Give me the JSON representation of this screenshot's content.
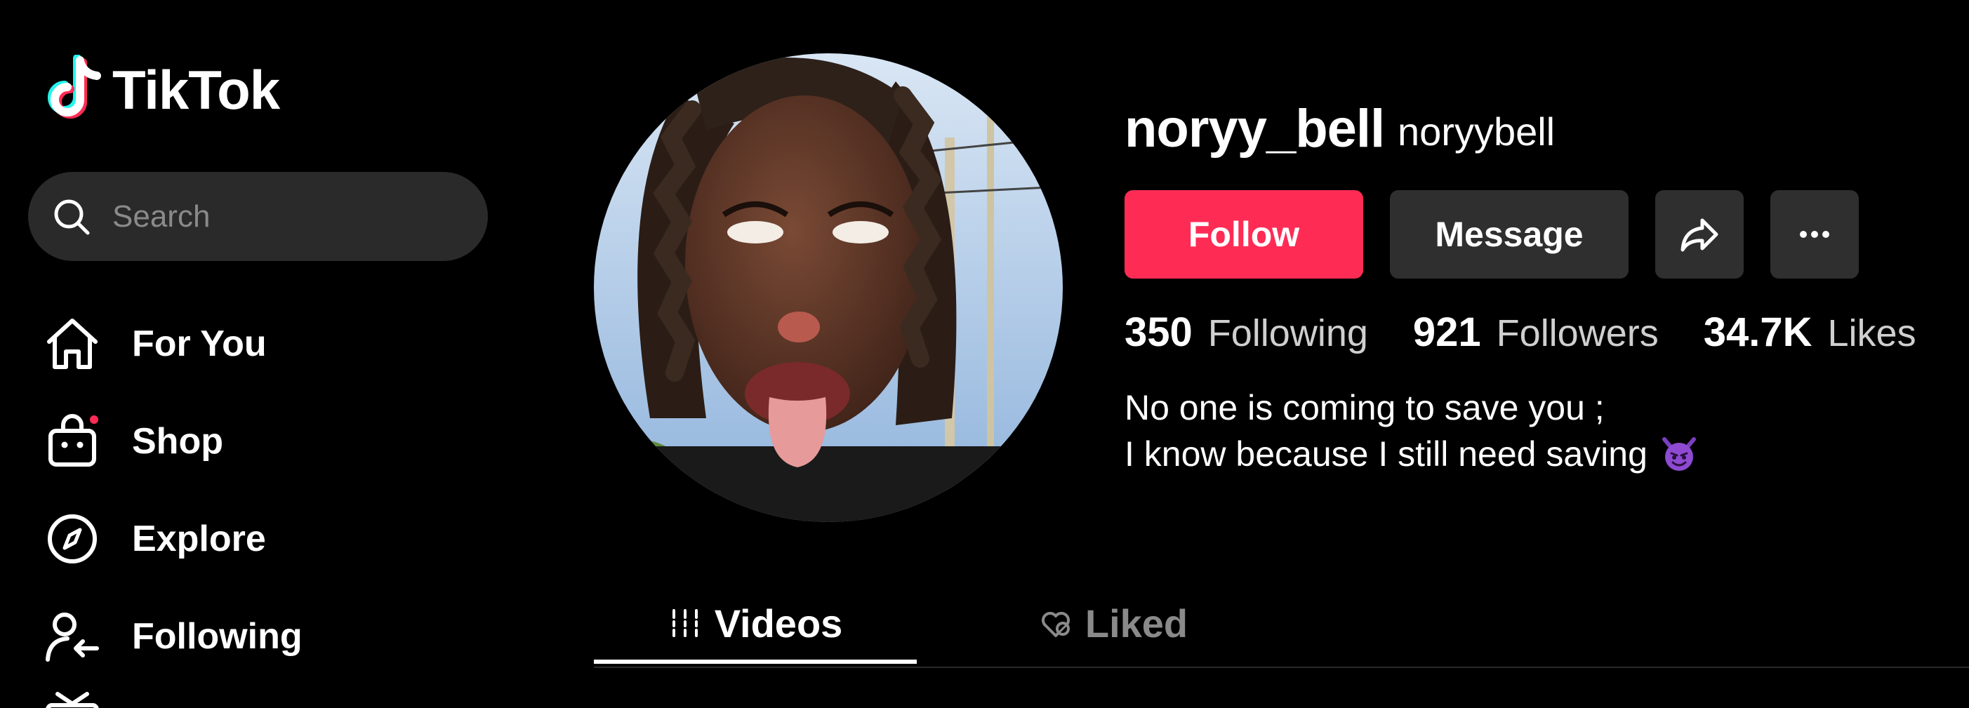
{
  "app": {
    "name": "TikTok",
    "accent_color": "#fe2c55"
  },
  "search": {
    "placeholder": "Search"
  },
  "sidebar": {
    "items": [
      {
        "label": "For You",
        "icon": "home-icon"
      },
      {
        "label": "Shop",
        "icon": "shopping-bag-icon",
        "has_notification_dot": true
      },
      {
        "label": "Explore",
        "icon": "compass-icon"
      },
      {
        "label": "Following",
        "icon": "following-user-icon"
      }
    ]
  },
  "profile": {
    "username": "noryy_bell",
    "nickname": "noryybell",
    "avatar_icon": "profile-photo",
    "actions": {
      "follow_label": "Follow",
      "message_label": "Message",
      "share_icon": "share-icon",
      "more_icon": "more-icon"
    },
    "stats": [
      {
        "value": "350",
        "label": "Following"
      },
      {
        "value": "921",
        "label": "Followers"
      },
      {
        "value": "34.7K",
        "label": "Likes"
      }
    ],
    "bio": [
      "No one is coming to save you ;",
      "I know because I still need saving"
    ],
    "bio_emoji": "smiling-devil-emoji"
  },
  "tabs": [
    {
      "label": "Videos",
      "icon": "grid-lines-icon",
      "active": true
    },
    {
      "label": "Liked",
      "icon": "liked-heart-icon",
      "active": false
    }
  ]
}
